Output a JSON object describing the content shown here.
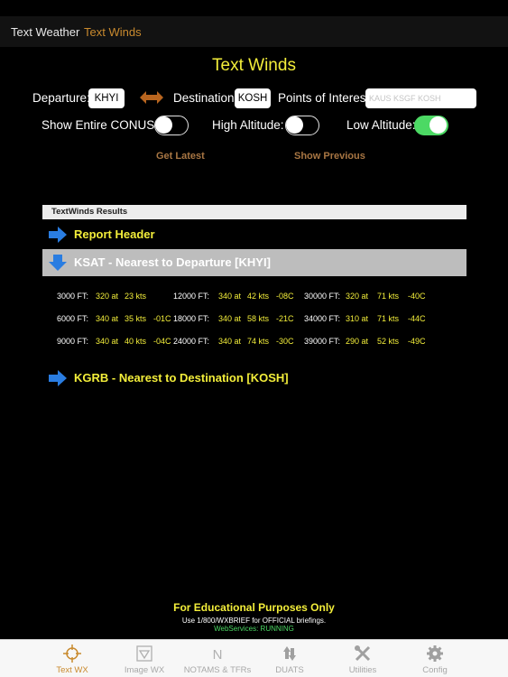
{
  "top_tabs": [
    "Text Weather",
    "Text Winds"
  ],
  "title": "Text Winds",
  "form": {
    "departure_label": "Departure:",
    "departure_value": "KHYI",
    "destination_label": "Destination:",
    "destination_value": "KOSH",
    "poi_label": "Points of Interest:",
    "poi_placeholder": "KAUS KSGF KOSH",
    "show_conus_label": "Show Entire CONUS:",
    "show_conus_on": false,
    "high_alt_label": "High Altitude:",
    "high_alt_on": false,
    "low_alt_label": "Low Altitude:",
    "low_alt_on": true
  },
  "buttons": {
    "get_latest": "Get Latest",
    "show_previous": "Show Previous"
  },
  "results": {
    "header": "TextWinds Results",
    "report_header": "Report Header",
    "departure_section": "KSAT - Nearest to Departure [KHYI]",
    "destination_section": "KGRB - Nearest to Destination [KOSH]",
    "winds": [
      [
        {
          "alt": "3000 FT:",
          "dir": "320 at",
          "spd": "23 kts",
          "temp": ""
        },
        {
          "alt": "12000 FT:",
          "dir": "340 at",
          "spd": "42 kts",
          "temp": "-08C"
        },
        {
          "alt": "30000 FT:",
          "dir": "320 at",
          "spd": "71 kts",
          "temp": "-40C"
        }
      ],
      [
        {
          "alt": "6000 FT:",
          "dir": "340 at",
          "spd": "35 kts",
          "temp": "-01C"
        },
        {
          "alt": "18000 FT:",
          "dir": "340 at",
          "spd": "58 kts",
          "temp": "-21C"
        },
        {
          "alt": "34000 FT:",
          "dir": "310 at",
          "spd": "71 kts",
          "temp": "-44C"
        }
      ],
      [
        {
          "alt": "9000 FT:",
          "dir": "340 at",
          "spd": "40 kts",
          "temp": "-04C"
        },
        {
          "alt": "24000 FT:",
          "dir": "340 at",
          "spd": "74 kts",
          "temp": "-30C"
        },
        {
          "alt": "39000 FT:",
          "dir": "290 at",
          "spd": "52 kts",
          "temp": "-49C"
        }
      ]
    ]
  },
  "footer": {
    "line1": "For Educational Purposes Only",
    "line2": "Use 1/800/WXBRIEF for OFFICIAL briefings.",
    "line3": "WebServices: RUNNING"
  },
  "tabbar": [
    {
      "label": "Text WX",
      "icon": "target-icon",
      "active": true
    },
    {
      "label": "Image WX",
      "icon": "image-wx-icon",
      "active": false
    },
    {
      "label": "NOTAMS & TFRs",
      "icon": "notams-icon",
      "active": false
    },
    {
      "label": "DUATS",
      "icon": "duats-icon",
      "active": false
    },
    {
      "label": "Utilities",
      "icon": "tools-icon",
      "active": false
    },
    {
      "label": "Config",
      "icon": "gear-icon",
      "active": false
    }
  ],
  "colors": {
    "accent_yellow": "#f3ee3a",
    "accent_orange": "#c98a2e",
    "toggle_on": "#4cd964",
    "arrow_blue": "#2a7de1"
  }
}
